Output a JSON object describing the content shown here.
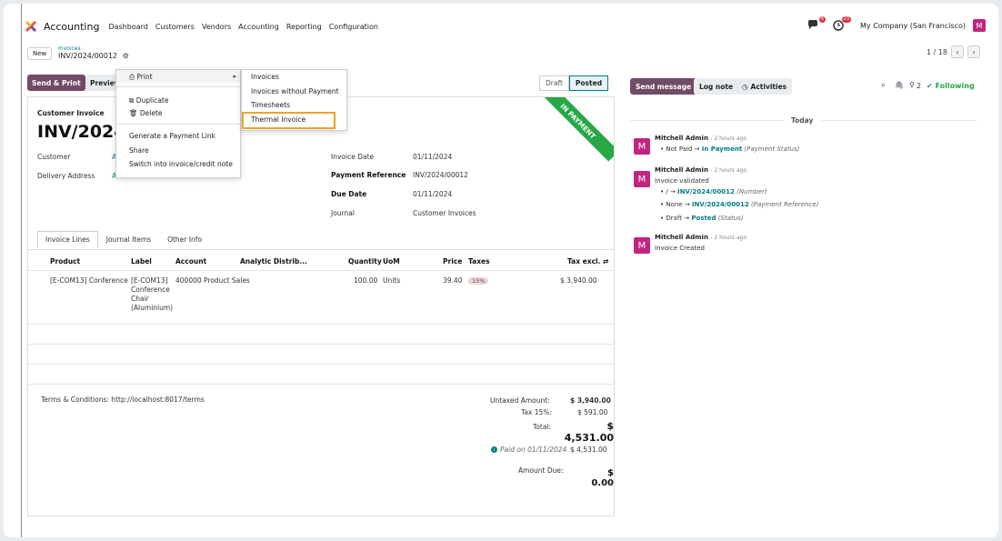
{
  "app": {
    "title": "Accounting",
    "nav": [
      "Dashboard",
      "Customers",
      "Vendors",
      "Accounting",
      "Reporting",
      "Configuration"
    ]
  },
  "topright": {
    "chat_badge": "6",
    "activity_badge": "23",
    "company": "My Company (San Francisco)",
    "avatar": "M"
  },
  "breadcrumb": {
    "new_label": "New",
    "parent": "Invoices",
    "current": "INV/2024/00012"
  },
  "pager": {
    "text": "1 / 18"
  },
  "actions": {
    "send_print": "Send & Print",
    "preview": "Preview"
  },
  "status": {
    "draft": "Draft",
    "posted": "Posted"
  },
  "ribbon": "IN PAYMENT",
  "menu": {
    "print": "Print",
    "duplicate": "Duplicate",
    "delete": "Delete",
    "gen_link": "Generate a Payment Link",
    "share": "Share",
    "switch": "Switch into invoice/credit note"
  },
  "submenu": [
    "Invoices",
    "Invoices without Payment",
    "Timesheets",
    "Thermal Invoice"
  ],
  "invoice": {
    "type": "Customer Invoice",
    "number": "INV/2024/",
    "customer_lbl": "Customer",
    "customer_val": "A",
    "delivery_lbl": "Delivery Address",
    "delivery_val": "A",
    "date_lbl": "Invoice Date",
    "date_val": "01/11/2024",
    "payref_lbl": "Payment Reference",
    "payref_val": "INV/2024/00012",
    "due_lbl": "Due Date",
    "due_val": "01/11/2024",
    "journal_lbl": "Journal",
    "journal_val": "Customer Invoices"
  },
  "tabs": [
    "Invoice Lines",
    "Journal Items",
    "Other Info"
  ],
  "columns": [
    "Product",
    "Label",
    "Account",
    "Analytic Distrib...",
    "Quantity",
    "UoM",
    "Price",
    "Taxes",
    "Tax excl."
  ],
  "line": {
    "product": "[E-COM13] Conference",
    "label": [
      "[E-COM13]",
      "Conference",
      "Chair",
      "(Aluminium)"
    ],
    "account": "400000 Product Sales",
    "qty": "100.00",
    "uom": "Units",
    "price": "39.40",
    "tax": "15%",
    "total": "$ 3,940.00"
  },
  "terms": "Terms & Conditions: http://localhost:8017/terms",
  "totals": {
    "untaxed_lbl": "Untaxed Amount:",
    "untaxed_val": "$ 3,940.00",
    "tax_lbl": "Tax 15%:",
    "tax_val": "$ 591.00",
    "total_lbl": "Total:",
    "total_val": "$ 4,531.00",
    "paid_lbl": "Paid on 01/11/2024",
    "paid_val": "$ 4,531.00",
    "due_lbl": "Amount Due:",
    "due_val": "$ 0.00"
  },
  "chatter": {
    "send_message": "Send message",
    "log_note": "Log note",
    "activities": "Activities",
    "followers": "2",
    "following": "Following",
    "today": "Today",
    "m1_author": "Mitchell Admin",
    "m1_time": "- 2 hours ago",
    "m1_from": "Not Paid",
    "m1_to": "In Payment",
    "m1_field": "(Payment Status)",
    "m2_author": "Mitchell Admin",
    "m2_time": "- 2 hours ago",
    "m2_body": "Invoice validated",
    "m2_l1_from": "/",
    "m2_l1_to": "INV/2024/00012",
    "m2_l1_field": "(Number)",
    "m2_l2_from": "None",
    "m2_l2_to": "INV/2024/00012",
    "m2_l2_field": "(Payment Reference)",
    "m2_l3_from": "Draft",
    "m2_l3_to": "Posted",
    "m2_l3_field": "(Status)",
    "m3_author": "Mitchell Admin",
    "m3_time": "- 2 hours ago",
    "m3_body": "Invoice Created",
    "avatar": "M"
  },
  "colors": {
    "brand": "#714b67",
    "teal": "#017e84",
    "ribbon": "#28a745",
    "highlight": "#f0a030"
  }
}
